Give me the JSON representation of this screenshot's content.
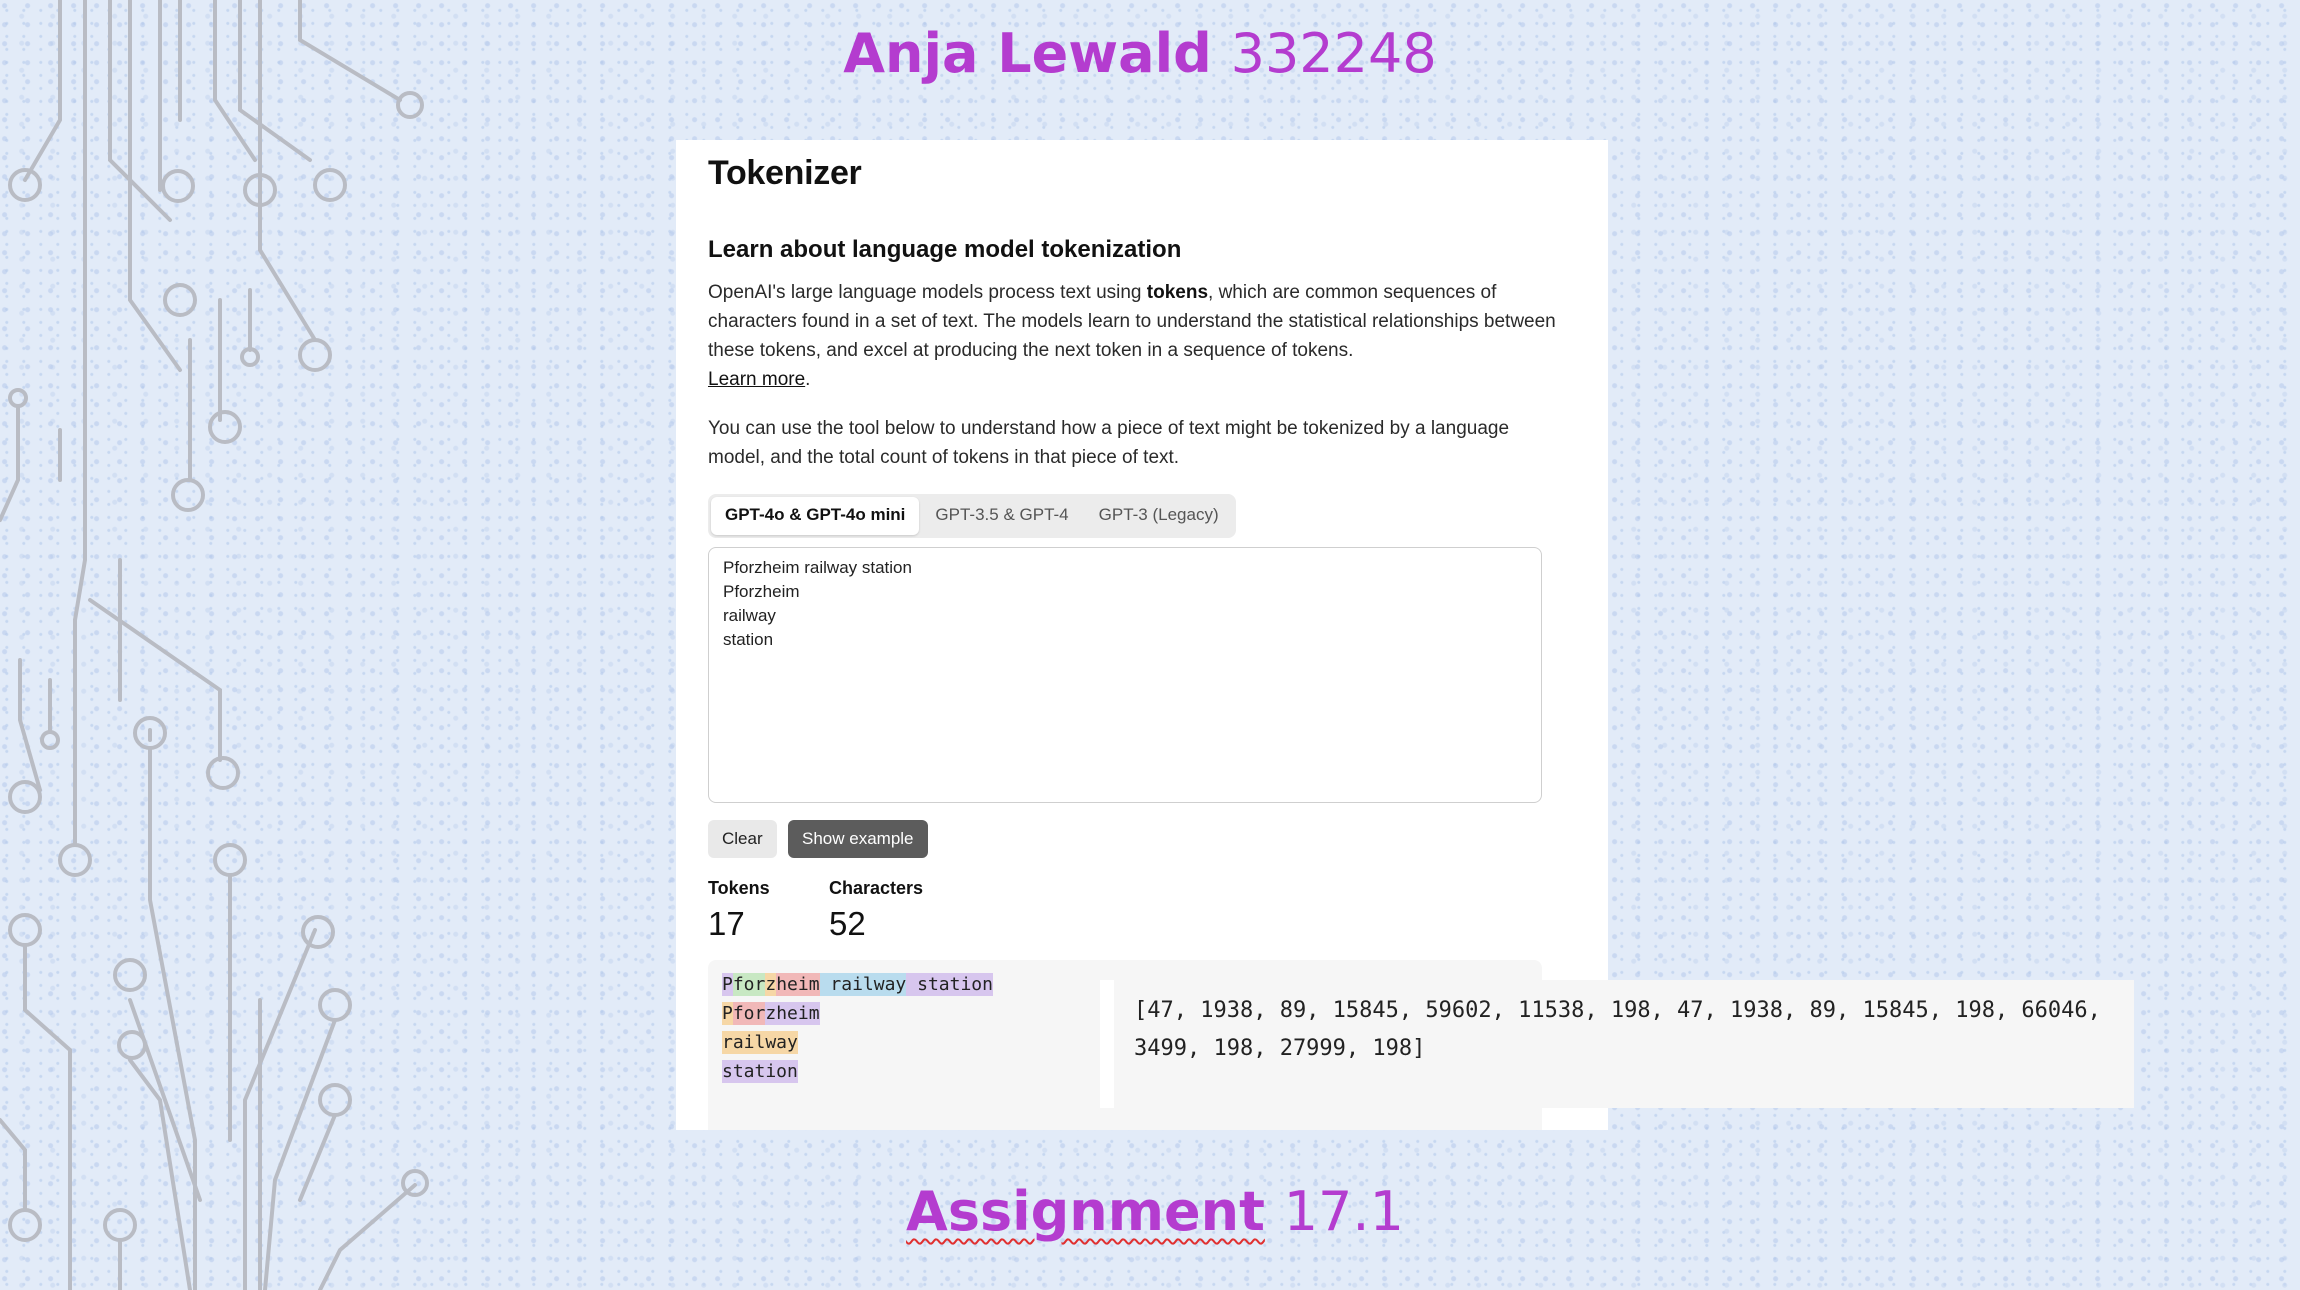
{
  "slide": {
    "author_name": "Anja Lewald",
    "author_id": "332248",
    "assignment_word": "Assignment",
    "assignment_number": "17.1"
  },
  "tokenizer": {
    "title": "Tokenizer",
    "subtitle": "Learn about language model tokenization",
    "intro_part1": "OpenAI's large language models process text using ",
    "intro_bold": "tokens",
    "intro_part2": ", which are common sequences of characters found in a set of text. The models learn to understand the statistical relationships between these tokens, and excel at producing the next token in a sequence of tokens.",
    "learn_more": "Learn more",
    "learn_more_suffix": ".",
    "usage_text": "You can use the tool below to understand how a piece of text might be tokenized by a language model, and the total count of tokens in that piece of text.",
    "tabs": [
      {
        "label": "GPT-4o & GPT-4o mini",
        "active": true
      },
      {
        "label": "GPT-3.5 & GPT-4",
        "active": false
      },
      {
        "label": "GPT-3 (Legacy)",
        "active": false
      }
    ],
    "input_text": "Pforzheim railway station\nPforzheim\nrailway\nstation",
    "clear_label": "Clear",
    "show_example_label": "Show example",
    "tokens_label": "Tokens",
    "tokens_value": "17",
    "characters_label": "Characters",
    "characters_value": "52",
    "token_lines": [
      [
        {
          "text": "P",
          "color": "c1"
        },
        {
          "text": "for",
          "color": "c2"
        },
        {
          "text": "z",
          "color": "c3"
        },
        {
          "text": "heim",
          "color": "c4"
        },
        {
          "text": " railway",
          "color": "c5"
        },
        {
          "text": " station",
          "color": "c1"
        }
      ],
      [
        {
          "text": "P",
          "color": "c3"
        },
        {
          "text": "for",
          "color": "c4"
        },
        {
          "text": "zheim",
          "color": "c1"
        }
      ],
      [
        {
          "text": "railway",
          "color": "c3"
        }
      ],
      [
        {
          "text": "station",
          "color": "c1"
        }
      ]
    ],
    "token_ids": "[47, 1938, 89, 15845, 59602, 11538, 198, 47, 1938, 89, 15845, 198, 66046, 3499, 198, 27999, 198]"
  },
  "colors": {
    "title_purple": "#b43ccf",
    "token_purple": "#d7c6ee",
    "token_green": "#c8e8c3",
    "token_orange": "#f6d7a6",
    "token_red": "#f1b8b8",
    "token_blue": "#b9dcee"
  }
}
